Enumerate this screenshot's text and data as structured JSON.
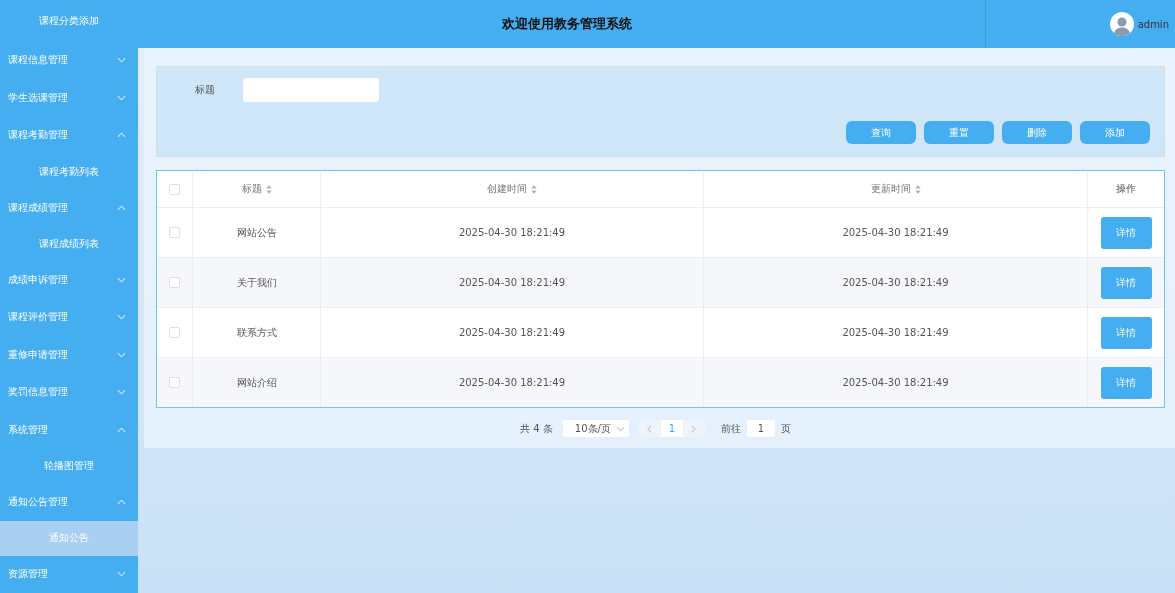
{
  "sidebar": {
    "items": [
      {
        "kind": "subitem",
        "label": "课程分类添加",
        "selected": false
      },
      {
        "kind": "group",
        "label": "课程信息管理",
        "expanded": false
      },
      {
        "kind": "group",
        "label": "学生选课管理",
        "expanded": false
      },
      {
        "kind": "group",
        "label": "课程考勤管理",
        "expanded": true,
        "children": [
          {
            "label": "课程考勤列表",
            "selected": false
          }
        ]
      },
      {
        "kind": "group",
        "label": "课程成绩管理",
        "expanded": true,
        "children": [
          {
            "label": "课程成绩列表",
            "selected": false
          }
        ]
      },
      {
        "kind": "group",
        "label": "成绩申诉管理",
        "expanded": false
      },
      {
        "kind": "group",
        "label": "课程评价管理",
        "expanded": false
      },
      {
        "kind": "group",
        "label": "重修申请管理",
        "expanded": false
      },
      {
        "kind": "group",
        "label": "奖罚信息管理",
        "expanded": false
      },
      {
        "kind": "group",
        "label": "系统管理",
        "expanded": true,
        "children": [
          {
            "label": "轮播图管理",
            "selected": false
          }
        ]
      },
      {
        "kind": "group",
        "label": "通知公告管理",
        "expanded": true,
        "children": [
          {
            "label": "通知公告",
            "selected": true
          }
        ]
      },
      {
        "kind": "group",
        "label": "资源管理",
        "expanded": false
      }
    ]
  },
  "header": {
    "title": "欢迎使用教务管理系统",
    "user": "admin"
  },
  "search": {
    "label": "标题",
    "buttons": [
      "查询",
      "重置",
      "删除",
      "添加"
    ]
  },
  "table": {
    "all_checked": false,
    "columns": [
      {
        "label": "标题",
        "sortable": true
      },
      {
        "label": "创建时间",
        "sortable": true
      },
      {
        "label": "更新时间",
        "sortable": true
      },
      {
        "label": "操作",
        "sortable": false
      }
    ],
    "rows": [
      {
        "checked": false,
        "cells": [
          "网站公告",
          "2025-04-30 18:21:49",
          "2025-04-30 18:21:49"
        ],
        "action": "详情"
      },
      {
        "checked": false,
        "cells": [
          "关于我们",
          "2025-04-30 18:21:49",
          "2025-04-30 18:21:49"
        ],
        "action": "详情"
      },
      {
        "checked": false,
        "cells": [
          "联系方式",
          "2025-04-30 18:21:49",
          "2025-04-30 18:21:49"
        ],
        "action": "详情"
      },
      {
        "checked": false,
        "cells": [
          "网站介绍",
          "2025-04-30 18:21:49",
          "2025-04-30 18:21:49"
        ],
        "action": "详情"
      }
    ]
  },
  "pagination": {
    "total": "共 4 条",
    "page_size": "10条/页",
    "pages": [
      {
        "label": "1",
        "selected": true
      }
    ],
    "goto_label": "前往",
    "goto_value": "1",
    "goto_unit": "页"
  }
}
